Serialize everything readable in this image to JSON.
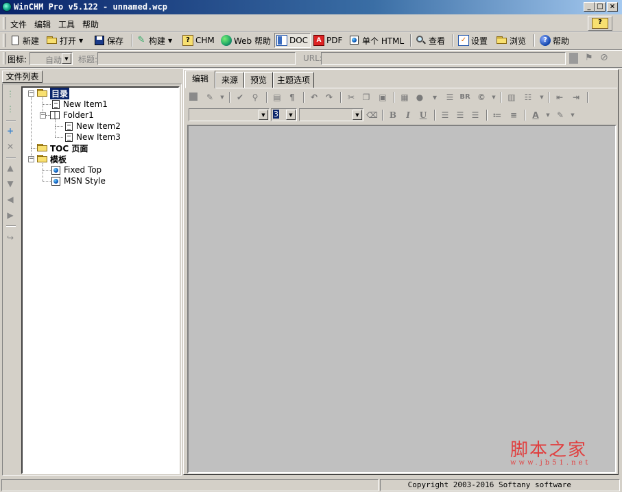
{
  "window": {
    "title": "WinCHM Pro v5.122 - unnamed.wcp",
    "minimize_glyph": "_",
    "maximize_glyph": "□",
    "close_glyph": "×"
  },
  "menu": {
    "items": [
      "文件",
      "编辑",
      "工具",
      "帮助"
    ]
  },
  "toolbar": {
    "buttons": [
      {
        "label": "新建",
        "icon": "new-doc-icon"
      },
      {
        "label": "打开",
        "icon": "open-folder-icon"
      },
      {
        "label": "保存",
        "icon": "save-disk-icon"
      },
      {
        "label": "构建",
        "icon": "build-icon"
      },
      {
        "label": "CHM",
        "icon": "chm-help-icon"
      },
      {
        "label": "Web 帮助",
        "icon": "web-globe-icon"
      },
      {
        "label": "DOC",
        "icon": "doc-icon"
      },
      {
        "label": "PDF",
        "icon": "pdf-icon"
      },
      {
        "label": "单个 HTML",
        "icon": "html-page-icon"
      },
      {
        "label": "查看",
        "icon": "view-magnifier-icon"
      },
      {
        "label": "设置",
        "icon": "settings-icon"
      },
      {
        "label": "浏览",
        "icon": "browse-folder-icon"
      },
      {
        "label": "帮助",
        "icon": "help-icon"
      }
    ],
    "pressed": "DOC"
  },
  "fields": {
    "icon_label": "图标:",
    "icon_value": "自动",
    "title_label": "标题:",
    "title_value": "",
    "url_label": "URL:",
    "url_value": ""
  },
  "left_panel": {
    "tab_label": "文件列表",
    "tools": [
      "add-child-icon",
      "add-sibling-icon",
      "add-icon",
      "delete-icon",
      "move-up-icon",
      "move-down-icon",
      "move-left-icon",
      "move-right-icon",
      "convert-icon"
    ]
  },
  "tree": {
    "nodes": [
      {
        "label": "目录",
        "type": "folder",
        "level": 0,
        "expanded": true,
        "selected": true,
        "bold": true
      },
      {
        "label": "New Item1",
        "type": "doc",
        "level": 1
      },
      {
        "label": "Folder1",
        "type": "book",
        "level": 1,
        "expanded": true
      },
      {
        "label": "New Item2",
        "type": "doc",
        "level": 2
      },
      {
        "label": "New Item3",
        "type": "doc",
        "level": 2
      },
      {
        "label": "TOC 页面",
        "type": "folder",
        "level": 0,
        "bold": true
      },
      {
        "label": "模板",
        "type": "folder",
        "level": 0,
        "expanded": true,
        "bold": true
      },
      {
        "label": "Fixed Top",
        "type": "template",
        "level": 1
      },
      {
        "label": "MSN Style",
        "type": "template",
        "level": 1
      }
    ]
  },
  "editor": {
    "tabs": [
      "编辑",
      "来源",
      "预览",
      "主题选项"
    ],
    "active_tab": "编辑",
    "font_size_value": "3",
    "bold_glyph": "B",
    "italic_glyph": "I",
    "underline_glyph": "U",
    "br_glyph": "BR"
  },
  "status": {
    "left": "",
    "copyright": "Copyright 2003-2016 Softany software"
  },
  "watermark": {
    "main": "脚本之家",
    "sub": "www.jb51.net"
  },
  "colors": {
    "titlebar_start": "#0a246a",
    "titlebar_end": "#a6caf0",
    "chrome": "#d4d0c8",
    "edit_area": "#c0c0c0",
    "selection": "#0a246a",
    "watermark": "#e04040"
  }
}
